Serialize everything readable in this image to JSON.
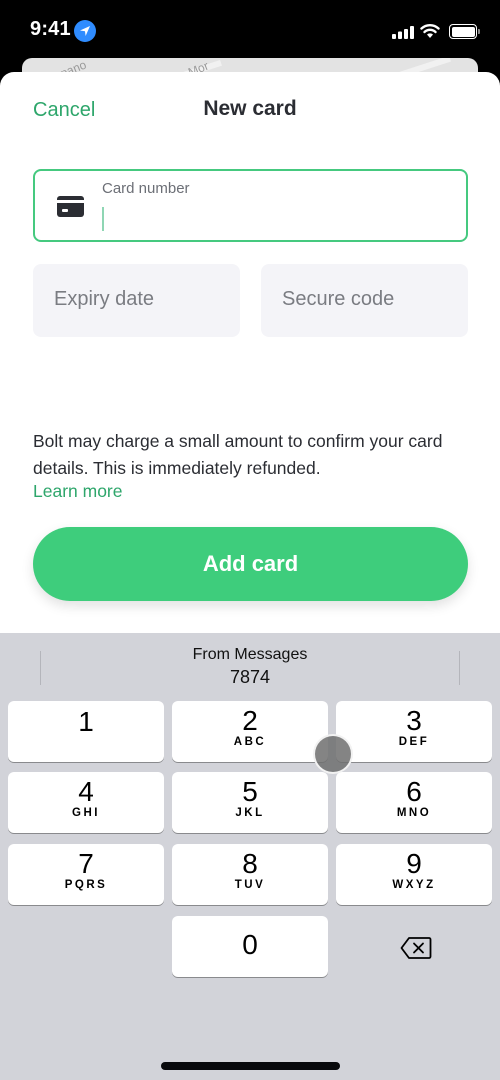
{
  "status_bar": {
    "time": "9:41",
    "icons": [
      "location-arrow-icon",
      "cellular-signal-icon",
      "wifi-icon",
      "battery-icon"
    ]
  },
  "background_map": {
    "labels": [
      "pano",
      "Mor"
    ]
  },
  "sheet": {
    "cancel_label": "Cancel",
    "title": "New card",
    "card_number": {
      "label": "Card number",
      "value": "",
      "icon": "credit-card-icon"
    },
    "expiry": {
      "placeholder": "Expiry date",
      "value": ""
    },
    "secure_code": {
      "placeholder": "Secure code",
      "value": ""
    },
    "info_text": "Bolt may charge a small amount to confirm your card details. This is immediately refunded.",
    "learn_more_label": "Learn more",
    "add_card_label": "Add card"
  },
  "keyboard": {
    "suggestion": {
      "source": "From Messages",
      "code": "7874"
    },
    "keys": [
      {
        "num": "1",
        "letters": ""
      },
      {
        "num": "2",
        "letters": "ABC"
      },
      {
        "num": "3",
        "letters": "DEF"
      },
      {
        "num": "4",
        "letters": "GHI"
      },
      {
        "num": "5",
        "letters": "JKL"
      },
      {
        "num": "6",
        "letters": "MNO"
      },
      {
        "num": "7",
        "letters": "PQRS"
      },
      {
        "num": "8",
        "letters": "TUV"
      },
      {
        "num": "9",
        "letters": "WXYZ"
      },
      {
        "num": "0",
        "letters": ""
      }
    ],
    "delete_icon": "backspace-icon"
  },
  "colors": {
    "accent_green": "#2ea66b",
    "button_green": "#3ecd7c",
    "focus_border": "#45c97f",
    "keyboard_bg": "#d2d3d9"
  }
}
